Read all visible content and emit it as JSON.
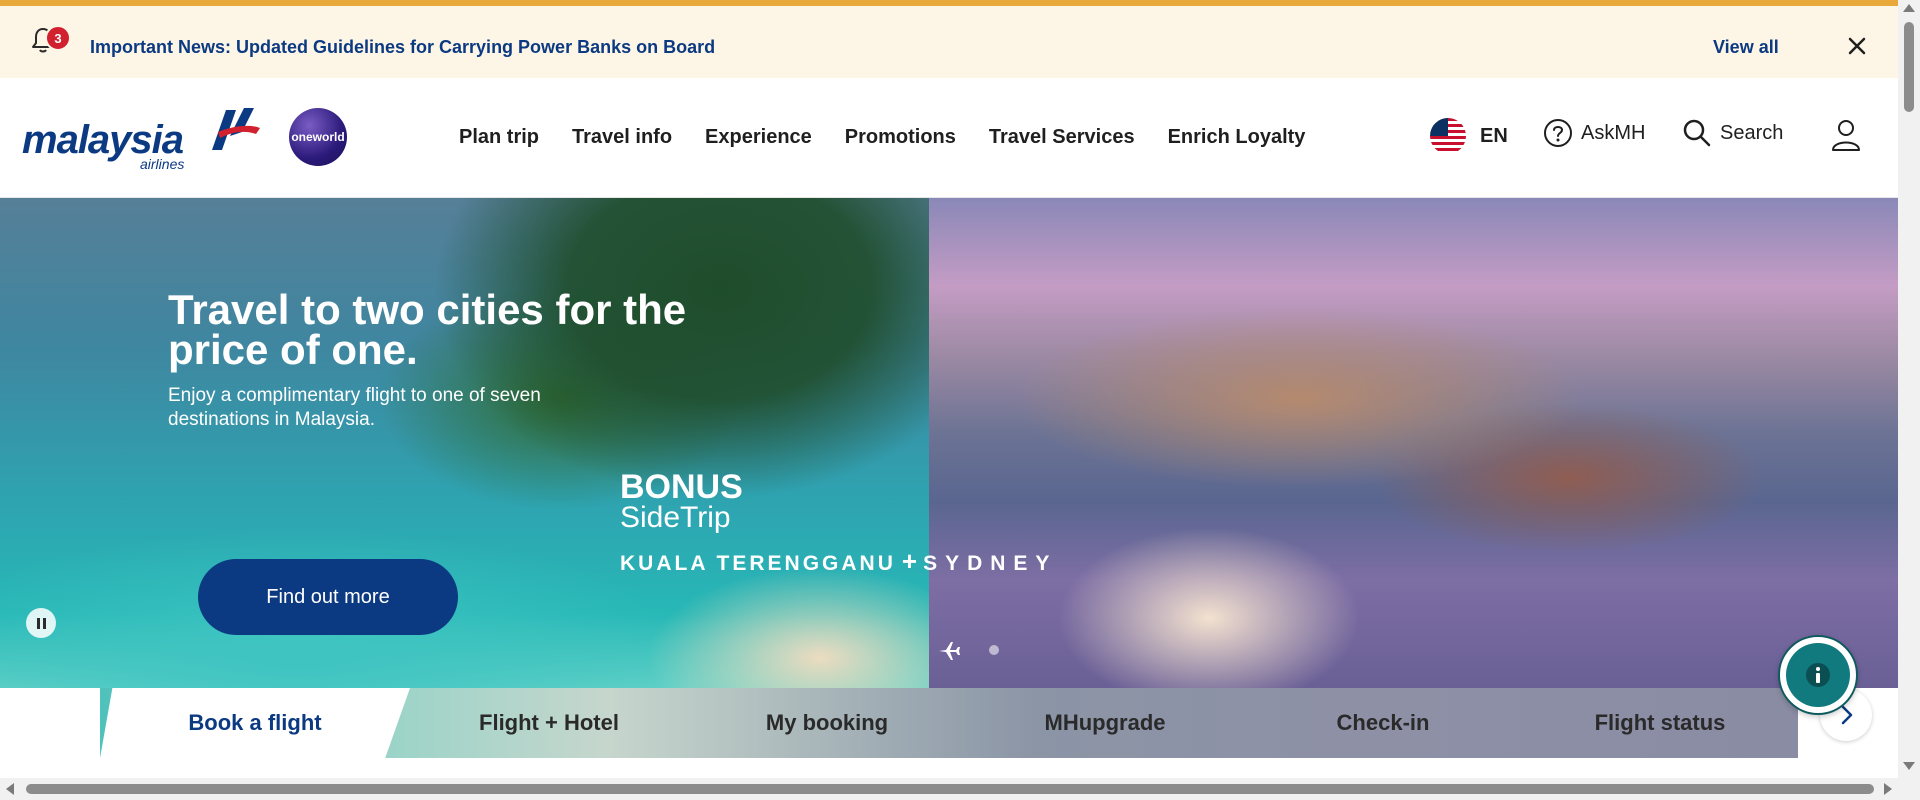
{
  "notification": {
    "count": "3",
    "message": "Important News: Updated Guidelines for Carrying Power Banks on Board",
    "view_all": "View all",
    "icons": {
      "bell": "bell-icon",
      "close": "close-icon"
    }
  },
  "header": {
    "logo": {
      "word": "malaysia",
      "sub": "airlines"
    },
    "alliance": "oneworld",
    "nav": [
      {
        "label": "Plan trip"
      },
      {
        "label": "Travel info"
      },
      {
        "label": "Experience"
      },
      {
        "label": "Promotions"
      },
      {
        "label": "Travel Services"
      },
      {
        "label": "Enrich Loyalty"
      }
    ],
    "language": "EN",
    "ask": "AskMH",
    "search": "Search",
    "icons": {
      "flag": "us-flag-icon",
      "ask": "help-circle-icon",
      "search": "search-icon",
      "user": "user-icon"
    }
  },
  "hero": {
    "title": "Travel to two cities for the price of one.",
    "subtitle": "Enjoy a complimentary flight to one of seven destinations in Malaysia.",
    "bonus": "BONUS",
    "sidetrip": "SideTrip",
    "city_a": "KUALA TERENGGANU",
    "plus": "+",
    "city_b": "SYDNEY",
    "cta": "Find out more"
  },
  "booking_tabs": [
    {
      "label": "Book a flight",
      "active": true
    },
    {
      "label": "Flight + Hotel",
      "active": false
    },
    {
      "label": "My booking",
      "active": false
    },
    {
      "label": "MHupgrade",
      "active": false
    },
    {
      "label": "Check-in",
      "active": false
    },
    {
      "label": "Flight status",
      "active": false
    }
  ],
  "colors": {
    "brand": "#0b3a82",
    "accent": "#e8a93a",
    "badge": "#d1202e",
    "info": "#107a7e"
  }
}
